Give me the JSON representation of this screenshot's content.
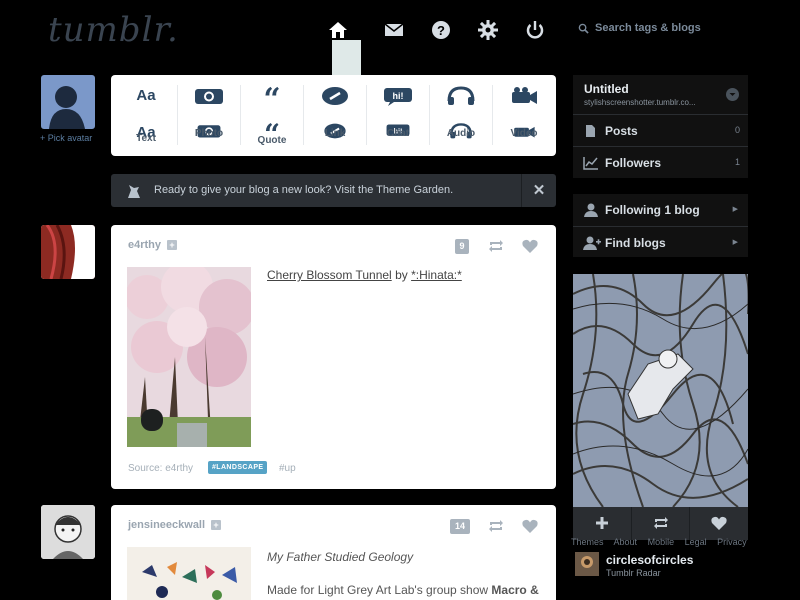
{
  "header": {
    "logo": "tumblr.",
    "search_placeholder": "Search tags & blogs",
    "nav": [
      "home-icon",
      "mail-icon",
      "help-icon",
      "gear-icon",
      "power-icon"
    ]
  },
  "left": {
    "pick_avatar": "+ Pick avatar"
  },
  "post_types": [
    "Text",
    "Photo",
    "Quote",
    "Link",
    "Chat",
    "Audio",
    "Video"
  ],
  "banner": {
    "text": "Ready to give your blog a new look? Visit the Theme Garden.",
    "close": "✕"
  },
  "posts": [
    {
      "author": "e4rthy",
      "notes": "9",
      "title_link": "Cherry Blossom Tunnel",
      "title_by": "by",
      "title_author": "*:Hinata:*",
      "source": "Source: e4rthy",
      "tag1": "#LANDSCAPE",
      "tag2": "#up"
    },
    {
      "author": "jensineeckwall",
      "notes": "14",
      "title": "My Father Studied Geology",
      "body_prefix": "Made for Light Grey Art Lab's group show ",
      "body_bold": "Macro &"
    }
  ],
  "sidebar": {
    "blog_title": "Untitled",
    "blog_url": "stylishscreenshotter.tumblr.co...",
    "rows": [
      {
        "label": "Posts",
        "value": "0"
      },
      {
        "label": "Followers",
        "value": "1"
      }
    ],
    "following": "Following 1 blog",
    "find": "Find blogs",
    "footer": [
      "Themes",
      "About",
      "Mobile",
      "Legal",
      "Privacy"
    ],
    "radar_name": "circlesofcircles",
    "radar_sub": "Tumblr Radar"
  },
  "colors": {
    "accent": "#2c4762",
    "tag": "#56a3c6",
    "bg": "#000000"
  }
}
